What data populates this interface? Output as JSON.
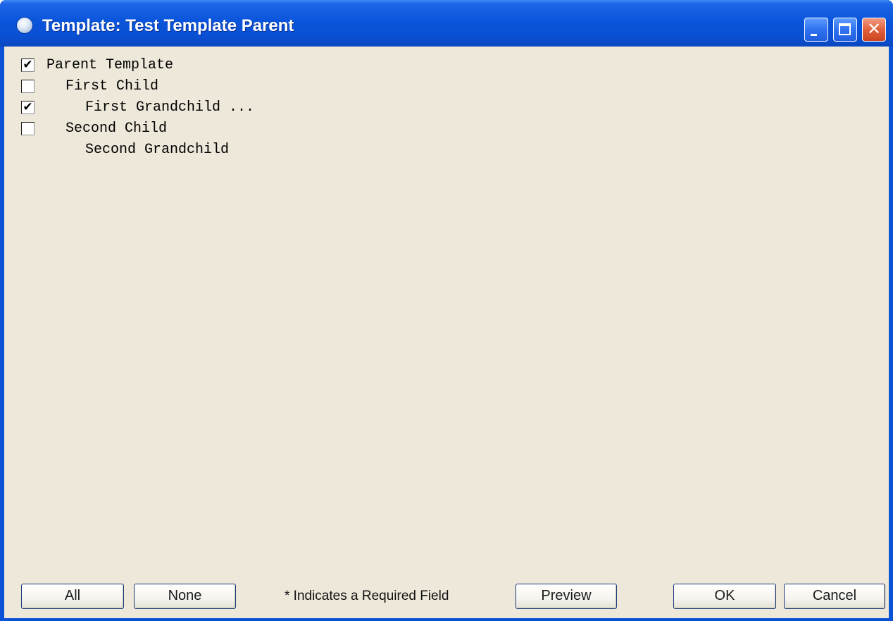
{
  "window": {
    "title": "Template: Test Template Parent",
    "icon": "app-globe-icon",
    "controls": {
      "minimize": "minimize-icon",
      "maximize": "maximize-icon",
      "close_glyph": "✕"
    }
  },
  "tree": {
    "items": [
      {
        "label": "Parent Template",
        "has_checkbox": true,
        "checked": true,
        "check_glyph": "✔",
        "indent_level": 0
      },
      {
        "label": "First Child",
        "has_checkbox": true,
        "checked": false,
        "check_glyph": "",
        "indent_level": 1
      },
      {
        "label": "First Grandchild ...",
        "has_checkbox": true,
        "checked": true,
        "check_glyph": "✔",
        "indent_level": 2
      },
      {
        "label": "Second Child",
        "has_checkbox": true,
        "checked": false,
        "check_glyph": "",
        "indent_level": 1
      },
      {
        "label": "Second Grandchild",
        "has_checkbox": false,
        "checked": false,
        "check_glyph": "",
        "indent_level": 2
      }
    ]
  },
  "footer": {
    "all_label": "All",
    "none_label": "None",
    "required_note": "* Indicates a Required Field",
    "preview_label": "Preview",
    "ok_label": "OK",
    "cancel_label": "Cancel"
  },
  "colors": {
    "titlebar": "#0a55dc",
    "client_background": "#ede8d9",
    "close_button": "#e2603c"
  }
}
